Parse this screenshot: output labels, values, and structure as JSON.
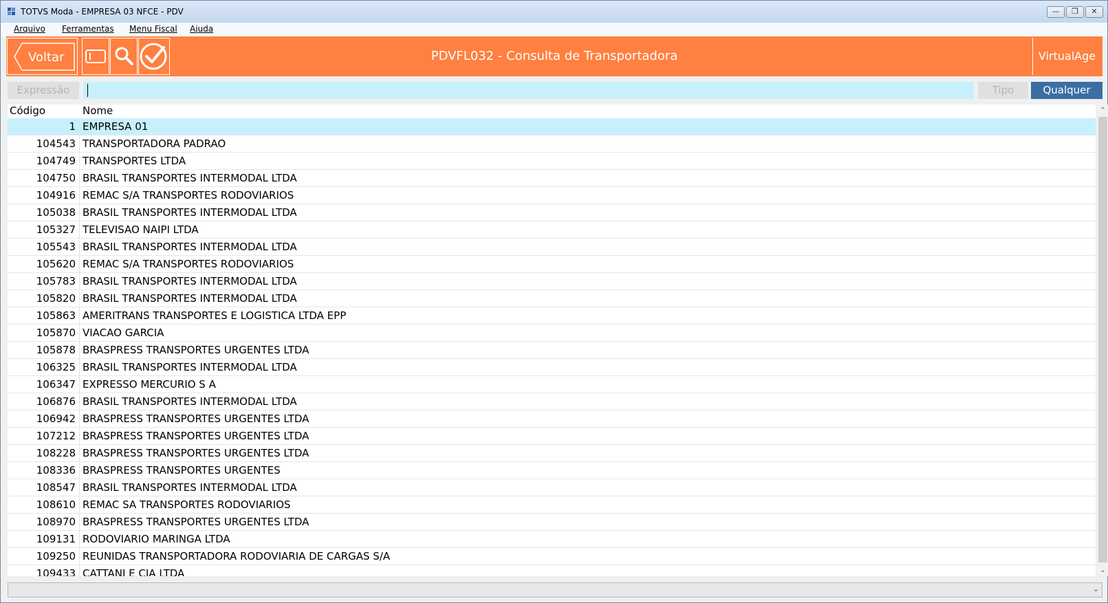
{
  "window": {
    "title": "TOTVS Moda - EMPRESA 03 NFCE - PDV",
    "minimize_glyph": "—",
    "restore_glyph": "❐",
    "close_glyph": "✕"
  },
  "menu": {
    "items": [
      "Arquivo",
      "Ferramentas",
      "Menu Fiscal",
      "Ajuda"
    ]
  },
  "header": {
    "back_label": "Voltar",
    "title": "PDVFL032 - Consulta de Transportadora",
    "brand": "VirtualAge",
    "color": "#ff8040",
    "icons": [
      "card-icon",
      "search-icon",
      "confirm-check-icon"
    ]
  },
  "search": {
    "label": "Expressão",
    "value": "",
    "type_label": "Tipo",
    "type_value": "Qualquer"
  },
  "grid": {
    "columns": [
      "Código",
      "Nome"
    ],
    "rows": [
      {
        "code": "1",
        "name": "EMPRESA 01"
      },
      {
        "code": "104543",
        "name": "TRANSPORTADORA PADRAO"
      },
      {
        "code": "104749",
        "name": "TRANSPORTES LTDA"
      },
      {
        "code": "104750",
        "name": "BRASIL TRANSPORTES INTERMODAL LTDA"
      },
      {
        "code": "104916",
        "name": "REMAC S/A TRANSPORTES RODOVIARIOS"
      },
      {
        "code": "105038",
        "name": "BRASIL TRANSPORTES INTERMODAL LTDA"
      },
      {
        "code": "105327",
        "name": "TELEVISAO  NAIPI  LTDA"
      },
      {
        "code": "105543",
        "name": "BRASIL TRANSPORTES INTERMODAL LTDA"
      },
      {
        "code": "105620",
        "name": "REMAC S/A TRANSPORTES RODOVIARIOS"
      },
      {
        "code": "105783",
        "name": "BRASIL TRANSPORTES INTERMODAL LTDA"
      },
      {
        "code": "105820",
        "name": "BRASIL TRANSPORTES INTERMODAL LTDA"
      },
      {
        "code": "105863",
        "name": "AMERITRANS TRANSPORTES E LOGISTICA LTDA EPP"
      },
      {
        "code": "105870",
        "name": "VIACAO GARCIA"
      },
      {
        "code": "105878",
        "name": "BRASPRESS TRANSPORTES URGENTES LTDA"
      },
      {
        "code": "106325",
        "name": "BRASIL TRANSPORTES INTERMODAL LTDA"
      },
      {
        "code": "106347",
        "name": "EXPRESSO MERCURIO S A"
      },
      {
        "code": "106876",
        "name": "BRASIL TRANSPORTES INTERMODAL LTDA"
      },
      {
        "code": "106942",
        "name": "BRASPRESS TRANSPORTES URGENTES LTDA"
      },
      {
        "code": "107212",
        "name": "BRASPRESS TRANSPORTES URGENTES LTDA"
      },
      {
        "code": "108228",
        "name": "BRASPRESS TRANSPORTES URGENTES LTDA"
      },
      {
        "code": "108336",
        "name": "BRASPRESS TRANSPORTES URGENTES"
      },
      {
        "code": "108547",
        "name": "BRASIL TRANSPORTES INTERMODAL LTDA"
      },
      {
        "code": "108610",
        "name": "REMAC SA TRANSPORTES RODOVIARIOS"
      },
      {
        "code": "108970",
        "name": "BRASPRESS TRANSPORTES URGENTES LTDA"
      },
      {
        "code": "109131",
        "name": "RODOVIARIO MARINGA LTDA"
      },
      {
        "code": "109250",
        "name": "REUNIDAS TRANSPORTADORA RODOVIARIA DE CARGAS S/A"
      },
      {
        "code": "109433",
        "name": "CATTANI E CIA LTDA"
      }
    ]
  },
  "scrollbar": {
    "up_glyph": "⌃",
    "down_glyph": "⌄"
  },
  "footer": {
    "combo_value": "",
    "combo_arrow": "⌄"
  }
}
